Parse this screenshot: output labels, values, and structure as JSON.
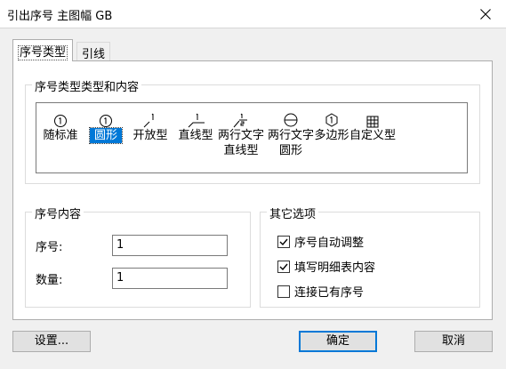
{
  "window": {
    "title": "引出序号 主图幅 GB"
  },
  "tabs": [
    {
      "label": "序号类型",
      "active": true
    },
    {
      "label": "引线",
      "active": false
    }
  ],
  "type_group": {
    "legend": "序号类型类型和内容",
    "items": [
      {
        "label": "随标准",
        "glyph": "①",
        "selected": false
      },
      {
        "label": "圆形",
        "glyph": "①",
        "selected": true
      },
      {
        "label": "开放型",
        "glyph": "1",
        "selected": false
      },
      {
        "label": "直线型",
        "glyph": "1",
        "selected": false
      },
      {
        "label": "两行文字",
        "label2": "直线型",
        "glyph": "1/2",
        "selected": false
      },
      {
        "label": "两行文字",
        "label2": "圆形",
        "glyph": "⊖",
        "selected": false
      },
      {
        "label": "多边形",
        "glyph": "①",
        "selected": false
      },
      {
        "label": "自定义型",
        "glyph": "田",
        "selected": false
      }
    ]
  },
  "content_group": {
    "legend": "序号内容",
    "serial_label": "序号:",
    "serial_value": "1",
    "count_label": "数量:",
    "count_value": "1"
  },
  "options_group": {
    "legend": "其它选项",
    "options": [
      {
        "label": "序号自动调整",
        "checked": true
      },
      {
        "label": "填写明细表内容",
        "checked": true
      },
      {
        "label": "连接已有序号",
        "checked": false
      }
    ]
  },
  "buttons": {
    "settings": "设置...",
    "ok": "确定",
    "cancel": "取消"
  },
  "colors": {
    "accent": "#0078d7"
  }
}
